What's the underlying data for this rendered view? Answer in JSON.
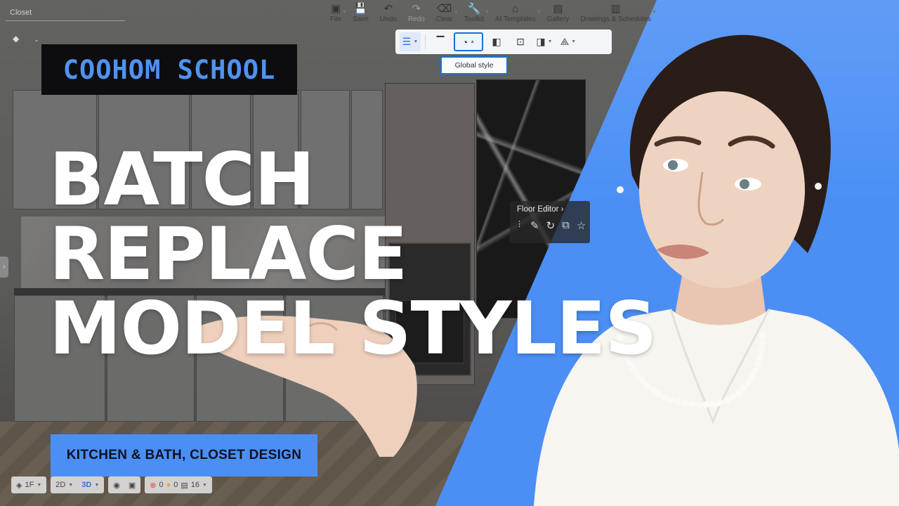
{
  "project": {
    "name": "Closet"
  },
  "top_menu": [
    {
      "label": "File",
      "icon": "file-icon",
      "glyph": "▣",
      "caret": true
    },
    {
      "label": "Save",
      "icon": "save-icon",
      "glyph": "💾",
      "caret": false
    },
    {
      "label": "Undo",
      "icon": "undo-icon",
      "glyph": "↶",
      "caret": false
    },
    {
      "label": "Redo",
      "icon": "redo-icon",
      "glyph": "↷",
      "caret": false,
      "disabled": true
    },
    {
      "label": "Clear",
      "icon": "eraser-icon",
      "glyph": "⌫",
      "caret": true
    },
    {
      "label": "Toolkit",
      "icon": "wrench-icon",
      "glyph": "🔧",
      "caret": true
    },
    {
      "label": "AI Templates",
      "icon": "ai-house-icon",
      "glyph": "⌂",
      "caret": true
    },
    {
      "label": "Gallery",
      "icon": "gallery-icon",
      "glyph": "▤",
      "caret": false
    },
    {
      "label": "Drawings & Schedules",
      "icon": "drawings-icon",
      "glyph": "▥",
      "caret": true
    }
  ],
  "toolbar": {
    "tooltip": "Global style"
  },
  "floor_editor": {
    "title": "Floor Editor",
    "chevron": "›"
  },
  "bottom_bar": {
    "floor": "1F",
    "view_2d": "2D",
    "view_3d": "3D",
    "errors": "0",
    "warnings": "0",
    "count": "16"
  },
  "thumbnail": {
    "brand": "COOHOM SCHOOL",
    "headline": [
      "BATCH",
      "REPLACE",
      "MODEL STYLES"
    ],
    "subtitle": "KITCHEN & BATH, CLOSET DESIGN"
  },
  "colors": {
    "accent_blue": "#4b8ff5",
    "brand_text": "#4f93f2",
    "highlight_border": "#1a6fe0",
    "headline": "#ffffff",
    "subtitle_bg": "#4b8ff5"
  }
}
